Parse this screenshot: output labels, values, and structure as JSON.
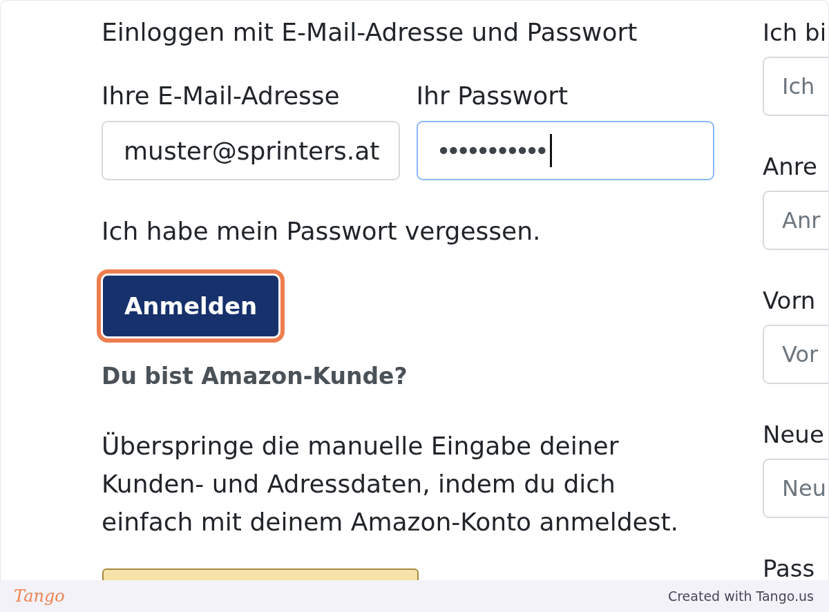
{
  "login": {
    "heading": "Einloggen mit E-Mail-Adresse und Passwort",
    "fields": [
      {
        "label": "Ihre E-Mail-Adresse",
        "value": "muster@sprinters.at",
        "focused": false
      },
      {
        "label": "Ihr Passwort",
        "value": "•••••••••••",
        "focused": true
      }
    ],
    "forgot_link": "Ich habe mein Passwort vergessen.",
    "submit": {
      "label": "Anmelden",
      "highlighted": true
    }
  },
  "amazon": {
    "heading": "Du bist Amazon-Kunde?",
    "text": "Überspringe die manuelle Eingabe deiner Kunden- und Adressdaten, indem du dich einfach mit deinem Amazon-Konto anmeldest."
  },
  "registration": {
    "fields": [
      {
        "label": "Ich bi",
        "placeholder": "Ich"
      },
      {
        "label": "Anre",
        "placeholder": "Anr"
      },
      {
        "label": "Vorn",
        "placeholder": "Vor"
      },
      {
        "label": "Neue",
        "placeholder": "Neu"
      },
      {
        "label": "Pass"
      }
    ]
  },
  "footer": {
    "logo": "Tango",
    "credit": "Created with Tango.us"
  }
}
